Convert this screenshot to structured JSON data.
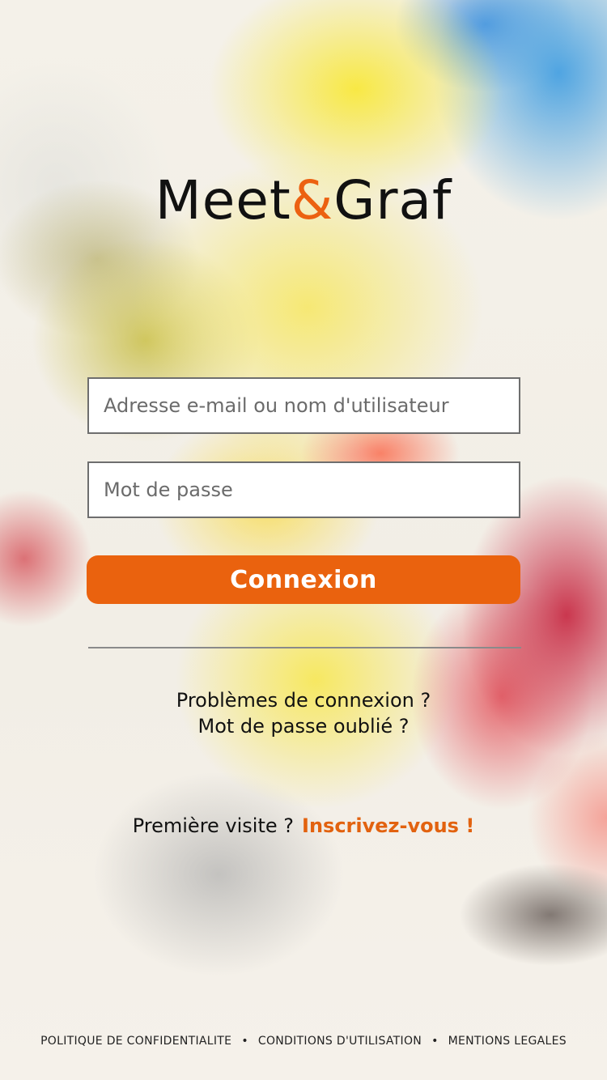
{
  "brand": {
    "name_part1": "Meet",
    "ampersand": "&",
    "name_part2": "Graf",
    "accent_color": "#ec6111"
  },
  "login_form": {
    "email_placeholder": "Adresse e-mail ou nom d'utilisateur",
    "email_value": "",
    "password_placeholder": "Mot de passe",
    "password_value": "",
    "submit_label": "Connexion"
  },
  "help_links": {
    "connection_problems": "Problèmes de connexion ?",
    "forgot_password": "Mot de passe oublié ?"
  },
  "signup": {
    "prompt": "Première visite ?",
    "cta": "Inscrivez-vous !"
  },
  "footer": {
    "privacy": "POLITIQUE DE CONFIDENTIALITE",
    "terms": "CONDITIONS D'UTILISATION",
    "legal": "MENTIONS LEGALES",
    "separator": "•"
  }
}
